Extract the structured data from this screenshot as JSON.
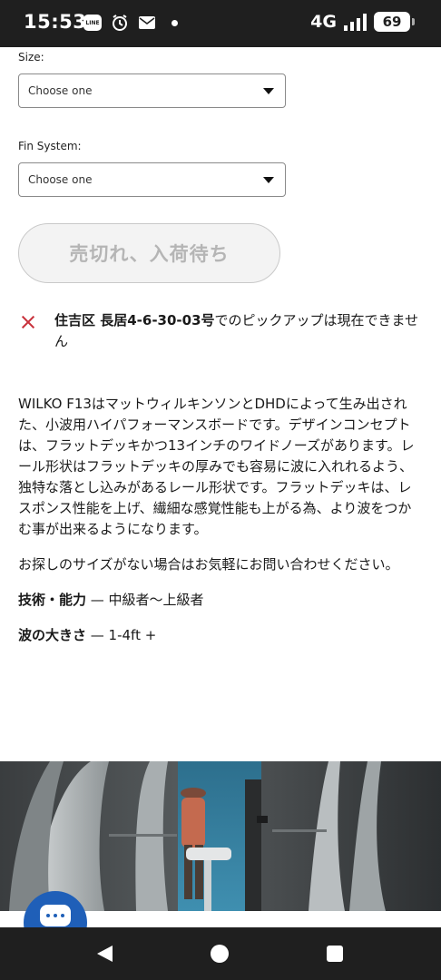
{
  "status_bar": {
    "time": "15:53",
    "line_app": "LINE",
    "network": "4G",
    "battery": "69"
  },
  "form": {
    "size_label": "Size:",
    "size_value": "Choose one",
    "fin_label": "Fin System:",
    "fin_value": "Choose one",
    "soldout_button": "売切れ、入荷待ち"
  },
  "pickup": {
    "location": "住吉区 長居4-6-30-03号",
    "message": "でのピックアップは現在できません"
  },
  "description": {
    "paragraph1": "WILKO F13はマットウィルキンソンとDHDによって生み出された、小波用ハイパフォーマンスボードです。デザインコンセプトは、フラットデッキかつ13インチのワイドノーズがあります。レール形状はフラットデッキの厚みでも容易に波に入れれるよう、独特な落とし込みがあるレール形状です。フラットデッキは、レスポンス性能を上げ、繊細な感覚性能も上がる為、より波をつかむ事が出来るようになります。",
    "paragraph2": "お探しのサイズがない場合はお気軽にお問い合わせください。",
    "skill_label": "技術・能力",
    "skill_value": " — 中級者〜上級者",
    "wave_label": "波の大きさ",
    "wave_value": " — 1-4ft +"
  },
  "colors": {
    "accent": "#1f5fb8",
    "error": "#c8323c",
    "system_bar": "#1f1f1f"
  },
  "icons": [
    "line-icon",
    "alarm-icon",
    "mail-icon",
    "signal-icon",
    "battery-icon",
    "close-icon",
    "chat-icon",
    "back-icon",
    "home-icon",
    "recents-icon"
  ]
}
